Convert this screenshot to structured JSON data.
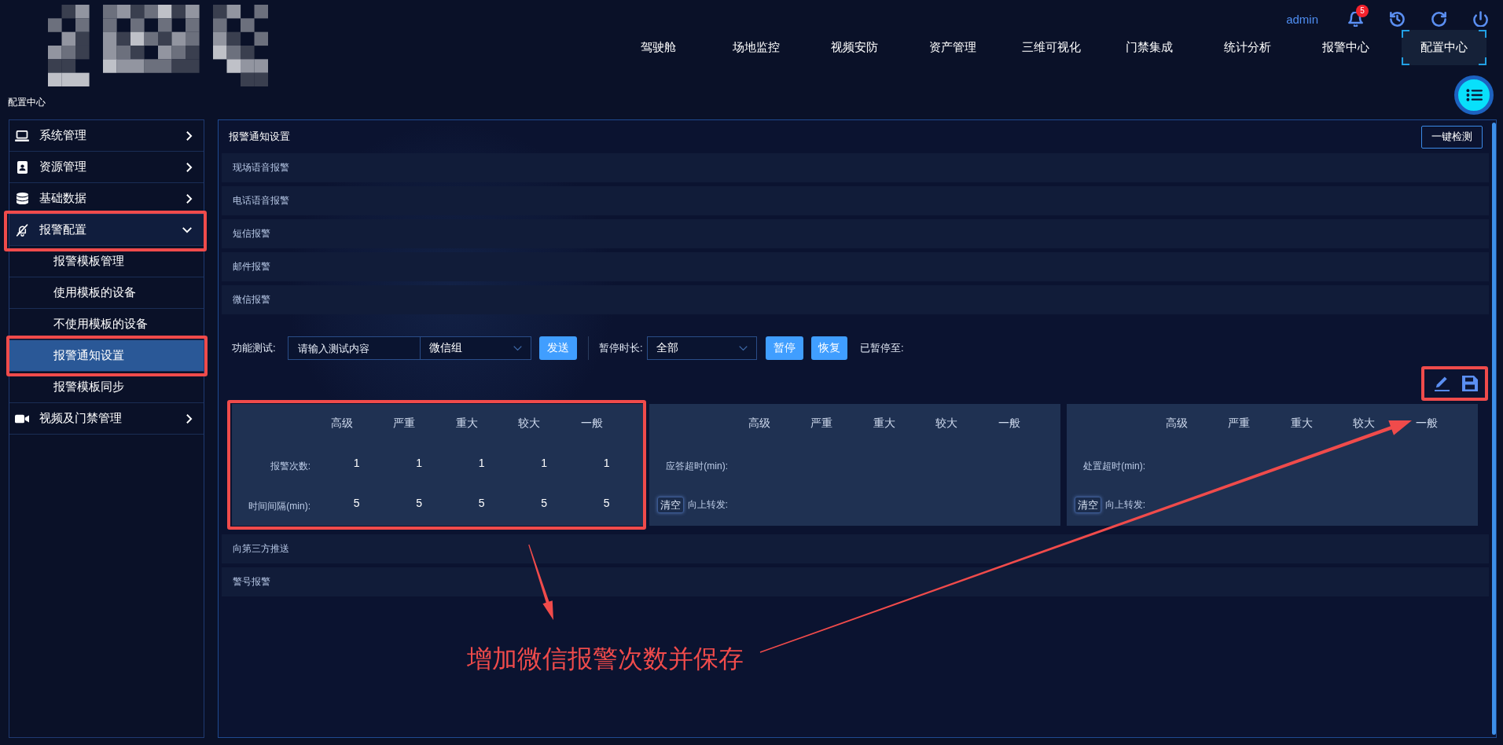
{
  "header": {
    "user": "admin",
    "notification_count": "5",
    "nav": [
      {
        "label": "驾驶舱",
        "selected": false
      },
      {
        "label": "场地监控",
        "selected": false
      },
      {
        "label": "视频安防",
        "selected": false
      },
      {
        "label": "资产管理",
        "selected": false
      },
      {
        "label": "三维可视化",
        "selected": false
      },
      {
        "label": "门禁集成",
        "selected": false
      },
      {
        "label": "统计分析",
        "selected": false
      },
      {
        "label": "报警中心",
        "selected": false
      },
      {
        "label": "配置中心",
        "selected": true
      }
    ]
  },
  "breadcrumb": "配置中心",
  "sidebar": {
    "items": [
      {
        "label": "系统管理",
        "expanded": false,
        "highlighted": false
      },
      {
        "label": "资源管理",
        "expanded": false,
        "highlighted": false
      },
      {
        "label": "基础数据",
        "expanded": false,
        "highlighted": false
      },
      {
        "label": "报警配置",
        "expanded": true,
        "highlighted": true,
        "children": [
          {
            "label": "报警模板管理",
            "selected": false,
            "highlighted": false
          },
          {
            "label": "使用模板的设备",
            "selected": false,
            "highlighted": false
          },
          {
            "label": "不使用模板的设备",
            "selected": false,
            "highlighted": false
          },
          {
            "label": "报警通知设置",
            "selected": true,
            "highlighted": true
          },
          {
            "label": "报警模板同步",
            "selected": false,
            "highlighted": false
          }
        ]
      },
      {
        "label": "视频及门禁管理",
        "expanded": false,
        "highlighted": false
      }
    ]
  },
  "panel": {
    "title": "报警通知设置",
    "check_button": "一键检测",
    "sections": [
      {
        "title": "现场语音报警"
      },
      {
        "title": "电话语音报警"
      },
      {
        "title": "短信报警"
      },
      {
        "title": "邮件报警"
      },
      {
        "title": "微信报警",
        "test_bar": {
          "label": "功能测试:",
          "input": {
            "placeholder": "请输入测试内容"
          },
          "group_select": {
            "value": "微信组"
          },
          "send_button": "发送",
          "pause_label": "暂停时长:",
          "pause_select": {
            "value": "全部"
          },
          "pause_button": "暂停",
          "resume_button": "恢复",
          "paused_until_label": "已暂停至:"
        },
        "toolbar": {
          "highlighted": true
        },
        "tables": [
          {
            "highlighted": true,
            "columns": [
              "高级",
              "严重",
              "重大",
              "较大",
              "一般"
            ],
            "rows": [
              {
                "label": "报警次数:",
                "values": [
                  "1",
                  "1",
                  "1",
                  "1",
                  "1"
                ]
              },
              {
                "label": "时间间隔(min):",
                "values": [
                  "5",
                  "5",
                  "5",
                  "5",
                  "5"
                ]
              }
            ]
          },
          {
            "highlighted": false,
            "columns": [
              "高级",
              "严重",
              "重大",
              "较大",
              "一般"
            ],
            "rows": [
              {
                "label": "应答超时(min):"
              },
              {
                "label": "向上转发:",
                "clear_button": "清空"
              }
            ]
          },
          {
            "highlighted": false,
            "columns": [
              "高级",
              "严重",
              "重大",
              "较大",
              "一般"
            ],
            "rows": [
              {
                "label": "处置超时(min):"
              },
              {
                "label": "向上转发:",
                "clear_button": "清空"
              }
            ]
          }
        ]
      },
      {
        "title": "向第三方推送"
      },
      {
        "title": "警号报警"
      }
    ]
  },
  "annotation": {
    "note": "增加微信报警次数并保存"
  }
}
